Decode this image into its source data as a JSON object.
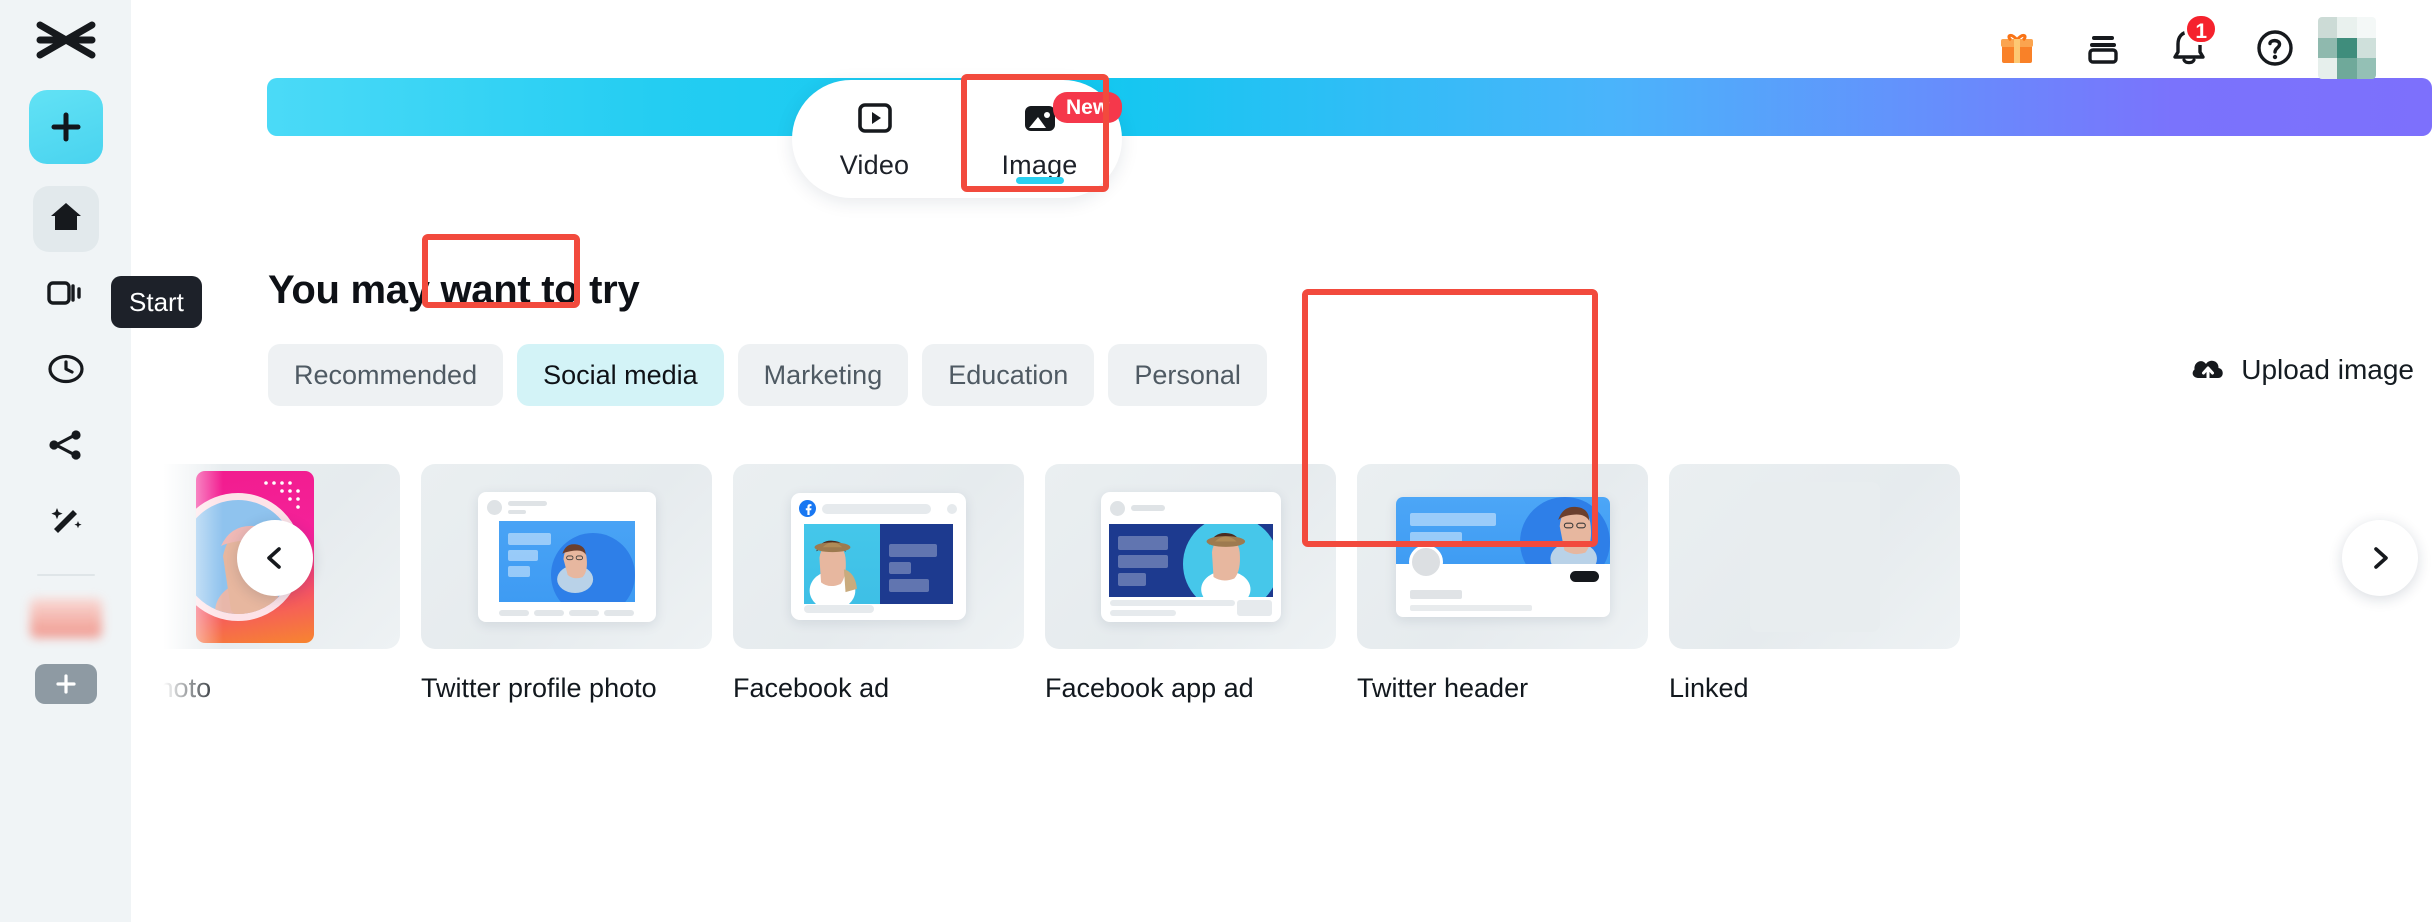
{
  "app": {
    "name": "CapCut",
    "logo_icon": "capcut-logo-icon"
  },
  "sidebar": {
    "create_button": {
      "label": "+",
      "icon": "plus-icon"
    },
    "items": [
      {
        "name": "home",
        "icon": "home-icon",
        "active": true,
        "tooltip": "Start"
      },
      {
        "name": "projects",
        "icon": "video-projects-icon",
        "active": false
      },
      {
        "name": "recent",
        "icon": "clock-icon",
        "active": false
      },
      {
        "name": "shared",
        "icon": "share-nodes-icon",
        "active": false
      },
      {
        "name": "tools",
        "icon": "magic-wand-icon",
        "active": false
      }
    ],
    "add_chip": {
      "icon": "plus-icon"
    }
  },
  "tooltip": {
    "text": "Start"
  },
  "header": {
    "icons": [
      {
        "name": "gift-icon",
        "label": "Gift"
      },
      {
        "name": "archive-box-icon",
        "label": "Archive"
      },
      {
        "name": "bell-icon",
        "label": "Notifications",
        "badge": "1"
      },
      {
        "name": "help-circle-icon",
        "label": "Help"
      }
    ],
    "avatar": {
      "name": "avatar",
      "label": "Account"
    }
  },
  "banner": {
    "gradient_start": "#4bdaf7",
    "gradient_mid": "#12c8f0",
    "gradient_end": "#7a73fc"
  },
  "mode_switch": {
    "tabs": [
      {
        "label": "Video",
        "icon": "video-play-icon",
        "active": false,
        "badge": ""
      },
      {
        "label": "Image",
        "icon": "image-icon",
        "active": true,
        "badge": "New"
      }
    ]
  },
  "main": {
    "title": "You may want to try",
    "categories": [
      {
        "label": "Recommended",
        "active": false
      },
      {
        "label": "Social media",
        "active": true
      },
      {
        "label": "Marketing",
        "active": false
      },
      {
        "label": "Education",
        "active": false
      },
      {
        "label": "Personal",
        "active": false
      }
    ],
    "upload": {
      "label": "Upload image",
      "icon": "cloud-upload-icon"
    },
    "carousel": {
      "prev_icon": "chevron-left-icon",
      "next_icon": "chevron-right-icon",
      "cards": [
        {
          "label": "ile photo",
          "kind": "instagram-profile",
          "clipped": true
        },
        {
          "label": "Twitter profile photo",
          "kind": "twitter-profile"
        },
        {
          "label": "Facebook ad",
          "kind": "facebook-ad"
        },
        {
          "label": "Facebook app ad",
          "kind": "facebook-app-ad"
        },
        {
          "label": "Twitter header",
          "kind": "twitter-header",
          "highlighted": true
        },
        {
          "label": "Linked",
          "kind": "linkedin",
          "clipped": true
        }
      ]
    }
  },
  "annotations": {
    "color": "#f24a3d",
    "boxes": [
      {
        "name": "image-tab-highlight",
        "target": "Image"
      },
      {
        "name": "social-media-pill-highlight",
        "target": "Social media"
      },
      {
        "name": "twitter-header-card-highlight",
        "target": "Twitter header"
      }
    ]
  }
}
